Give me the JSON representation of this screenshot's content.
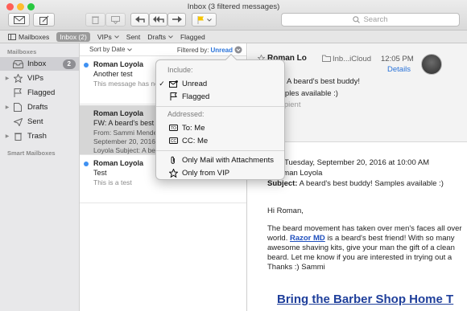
{
  "window": {
    "title": "Inbox (3 filtered messages)"
  },
  "toolbar": {
    "search_placeholder": "Search",
    "buttons": [
      "compose-icon",
      "new-message-icon",
      "trash-icon",
      "junk-icon",
      "reply-icon",
      "reply-all-icon",
      "forward-icon",
      "flag-icon"
    ]
  },
  "favorites": {
    "mailboxes": "Mailboxes",
    "inbox": "Inbox (2)",
    "vips": "VIPs",
    "sent": "Sent",
    "drafts": "Drafts",
    "flagged": "Flagged"
  },
  "sidebar": {
    "heading": "Mailboxes",
    "smart_heading": "Smart Mailboxes",
    "items": [
      {
        "label": "Inbox",
        "badge": "2",
        "selected": true
      },
      {
        "label": "VIPs"
      },
      {
        "label": "Flagged"
      },
      {
        "label": "Drafts"
      },
      {
        "label": "Sent"
      },
      {
        "label": "Trash"
      }
    ]
  },
  "list": {
    "sort_label": "Sort by Date",
    "filter_label": "Filtered by:",
    "filter_value": "Unread",
    "messages": [
      {
        "from": "Roman Loyola",
        "time": "12",
        "subject": "Another test",
        "preview": "This message has no",
        "unread": true
      },
      {
        "from": "Roman Loyola",
        "subject": "FW: A beard's best",
        "preview1": "From: Sammi Mende",
        "preview2": "September 20, 2016",
        "preview3": "Loyola Subject: A be",
        "unread": false,
        "selected": true
      },
      {
        "from": "Roman Loyola",
        "subject": "Test",
        "preview": "This is a test",
        "unread": true
      }
    ]
  },
  "popover": {
    "include_heading": "Include:",
    "addressed_heading": "Addressed:",
    "items": {
      "unread": "Unread",
      "flagged": "Flagged",
      "to_me": "To: Me",
      "cc_me": "CC: Me",
      "attachments": "Only Mail with Attachments",
      "vip": "Only from VIP"
    },
    "to_icon_text": "TO",
    "cc_icon_text": "CC"
  },
  "reader": {
    "from_name": "Roman Lo",
    "mailbox": "Inb...iCloud",
    "time": "12:05 PM",
    "details": "Details",
    "subject_header": "A beard's best buddy!",
    "subject_line2": "mples available :)",
    "recipient": "cipient",
    "fwd_date": "Tuesday, September 20, 2016 at 10:00 AM",
    "fwd_to": "oman Loyola",
    "subject_label": "Subject:",
    "subject_value": "A beard's best buddy! Samples available :)",
    "greeting": "Hi Roman,",
    "body_1": "The beard movement has taken over men's faces all over",
    "body_2a": "world.",
    "body_2_link": "Razor MD",
    "body_2b": "is a beard's best friend! With so many",
    "body_3": "awesome shaving kits, give your man the gift of a clean",
    "body_4": "beard. Let me know if you are interested in trying out a",
    "body_5": "Thanks :) Sammi",
    "banner": "Bring the Barber Shop Home T"
  }
}
